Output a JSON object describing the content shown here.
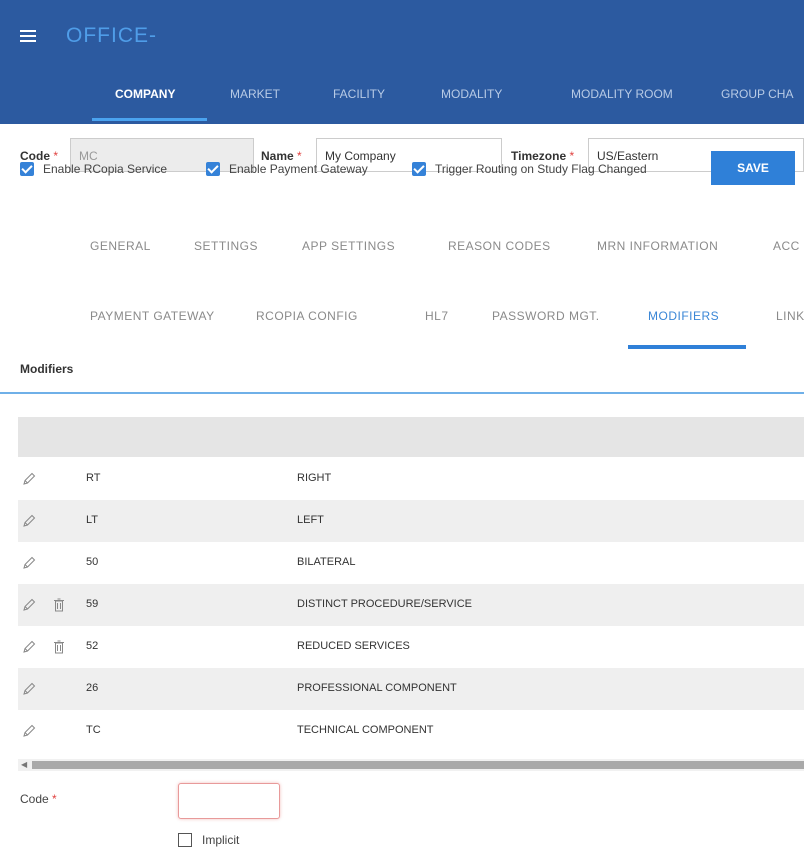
{
  "app": {
    "title": "OFFICE-"
  },
  "colors": {
    "header_bg": "#2c5aa0",
    "accent": "#2f80d8",
    "required": "#e0413f"
  },
  "top_nav": {
    "items": [
      {
        "label": "COMPANY",
        "active": true
      },
      {
        "label": "MARKET"
      },
      {
        "label": "FACILITY"
      },
      {
        "label": "MODALITY"
      },
      {
        "label": "MODALITY ROOM"
      },
      {
        "label": "GROUP CHA"
      }
    ]
  },
  "company_form": {
    "code_label": "Code",
    "code_value": "MC",
    "name_label": "Name",
    "name_value": "My Company",
    "timezone_label": "Timezone",
    "timezone_value": "US/Eastern",
    "required_mark": "*",
    "checkboxes": [
      {
        "label": "Enable RCopia Service",
        "checked": true
      },
      {
        "label": "Enable Payment Gateway",
        "checked": true
      },
      {
        "label": "Trigger Routing on Study Flag Changed",
        "checked": true
      }
    ],
    "save_label": "SAVE"
  },
  "sub_tabs_row1": [
    "GENERAL",
    "SETTINGS",
    "APP SETTINGS",
    "REASON CODES",
    "MRN INFORMATION",
    "ACC"
  ],
  "sub_tabs_row2": [
    "PAYMENT GATEWAY",
    "RCOPIA CONFIG",
    "HL7",
    "PASSWORD MGT.",
    "MODIFIERS",
    "LINK"
  ],
  "active_sub_tab": "MODIFIERS",
  "modifiers": {
    "heading": "Modifiers",
    "rows": [
      {
        "code": "RT",
        "description": "RIGHT",
        "deletable": false
      },
      {
        "code": "LT",
        "description": "LEFT",
        "deletable": false
      },
      {
        "code": "50",
        "description": "BILATERAL",
        "deletable": false
      },
      {
        "code": "59",
        "description": "DISTINCT PROCEDURE/SERVICE",
        "deletable": true
      },
      {
        "code": "52",
        "description": "REDUCED SERVICES",
        "deletable": true
      },
      {
        "code": "26",
        "description": "PROFESSIONAL COMPONENT",
        "deletable": false
      },
      {
        "code": "TC",
        "description": "TECHNICAL COMPONENT",
        "deletable": false
      }
    ]
  },
  "new_modifier": {
    "code_label": "Code",
    "required_mark": "*",
    "code_value": "",
    "implicit_label": "Implicit",
    "implicit_checked": false
  }
}
